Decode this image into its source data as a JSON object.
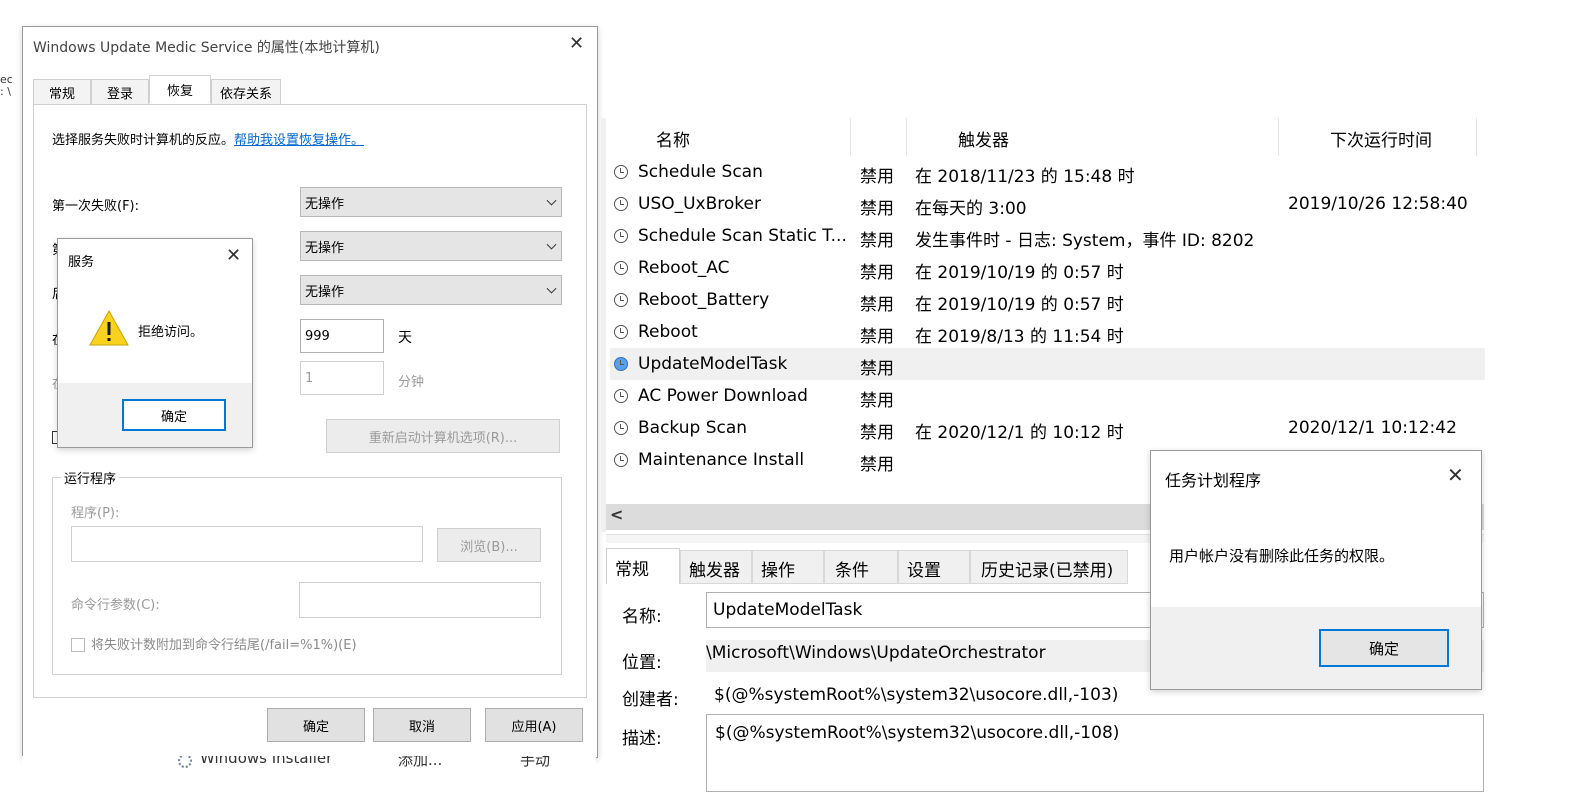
{
  "props_dialog": {
    "title": "Windows Update Medic Service 的属性(本地计算机)",
    "tabs": [
      "常规",
      "登录",
      "恢复",
      "依存关系"
    ],
    "intro": "选择服务失败时计算机的反应。",
    "help_link": "帮助我设置恢复操作。",
    "first_failure_label": "第一次失败(F):",
    "first_failure_value": "无操作",
    "second_failure_value": "无操作",
    "subsequent_failure_value": "无操作",
    "reset_days_value": "999",
    "reset_days_unit": "天",
    "restart_minutes_value": "1",
    "restart_minutes_unit": "分钟",
    "restart_options_button": "重新启动计算机选项(R)...",
    "run_program_group": "运行程序",
    "program_label": "程序(P):",
    "browse_button": "浏览(B)...",
    "cmdline_label": "命令行参数(C):",
    "fail_count_checkbox": "将失败计数附加到命令行结尾(/fail=%1%)(E)",
    "ok": "确定",
    "cancel": "取消",
    "apply": "应用(A)",
    "behind_row": {
      "name": "Windows Installer",
      "action": "添加...",
      "startup": "手动"
    }
  },
  "service_alert": {
    "title": "服务",
    "message": "拒绝访问。",
    "ok": "确定",
    "icon": "warning-icon"
  },
  "task_list": {
    "columns": [
      "名称",
      "触发器",
      "下次运行时间"
    ],
    "rows": [
      {
        "name": "Schedule Scan",
        "status": "禁用",
        "trigger": "在 2018/11/23 的 15:48 时",
        "next": ""
      },
      {
        "name": "USO_UxBroker",
        "status": "禁用",
        "trigger": "在每天的 3:00",
        "next": "2019/10/26 12:58:40"
      },
      {
        "name": "Schedule Scan Static T...",
        "status": "禁用",
        "trigger": "发生事件时 - 日志: System，事件 ID: 8202",
        "next": ""
      },
      {
        "name": "Reboot_AC",
        "status": "禁用",
        "trigger": "在 2019/10/19 的 0:57 时",
        "next": ""
      },
      {
        "name": "Reboot_Battery",
        "status": "禁用",
        "trigger": "在 2019/10/19 的 0:57 时",
        "next": ""
      },
      {
        "name": "Reboot",
        "status": "禁用",
        "trigger": "在 2019/8/13 的 11:54 时",
        "next": ""
      },
      {
        "name": "UpdateModelTask",
        "status": "禁用",
        "trigger": "",
        "next": ""
      },
      {
        "name": "AC Power Download",
        "status": "禁用",
        "trigger": "",
        "next": ""
      },
      {
        "name": "Backup Scan",
        "status": "禁用",
        "trigger": "在 2020/12/1 的 10:12 时",
        "next": "2020/12/1 10:12:42"
      },
      {
        "name": "Maintenance Install",
        "status": "禁用",
        "trigger": "",
        "next": ""
      }
    ],
    "scroll_left": "<"
  },
  "task_detail": {
    "tabs": [
      "常规",
      "触发器",
      "操作",
      "条件",
      "设置",
      "历史记录(已禁用)"
    ],
    "name_label": "名称:",
    "name_value": "UpdateModelTask",
    "location_label": "位置:",
    "location_value": "\\Microsoft\\Windows\\UpdateOrchestrator",
    "author_label": "创建者:",
    "author_value": "$(@%systemRoot%\\system32\\usocore.dll,-103)",
    "desc_label": "描述:",
    "desc_value": "$(@%systemRoot%\\system32\\usocore.dll,-108)"
  },
  "scheduler_alert": {
    "title": "任务计划程序",
    "message": "用户帐户没有删除此任务的权限。",
    "ok": "确定"
  },
  "edge_fragment": {
    "line1": "ec",
    "line2": ": \\"
  }
}
